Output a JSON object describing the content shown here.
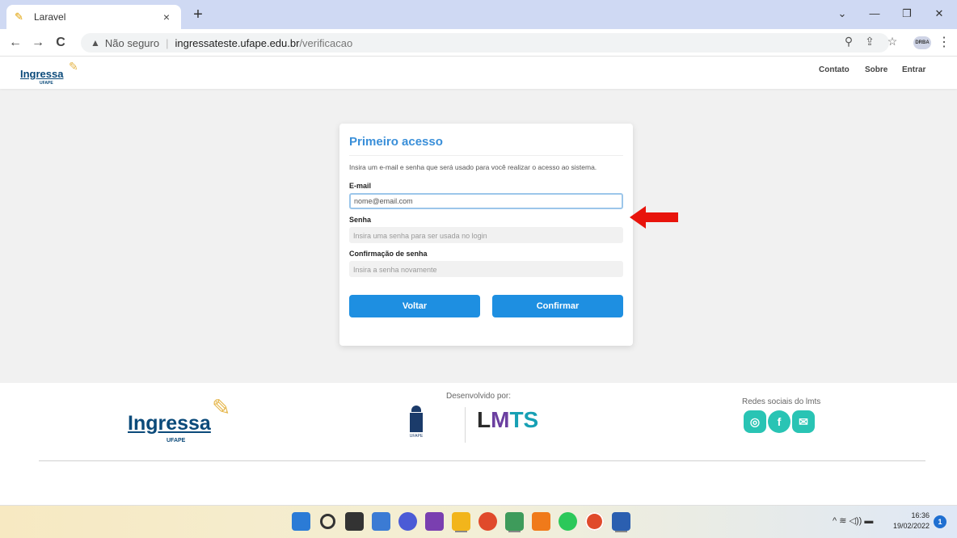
{
  "browser": {
    "tab_title": "Laravel",
    "tab_close": "×",
    "new_tab": "+",
    "security_text": "Não seguro",
    "url_host": "ingressateste.ufape.edu.br",
    "url_path": "/verificacao",
    "back": "←",
    "forward": "→",
    "reload": "C",
    "zoom_icon": "⚲",
    "share_icon": "⇪",
    "bookmark_icon": "☆",
    "profile_label": "DRBA",
    "menu": "⋮",
    "minimize": "—",
    "restore": "❐",
    "close": "✕",
    "chevron": "⌄"
  },
  "header": {
    "logo_text": "Ingressa",
    "logo_sub": "UFAPE",
    "nav": [
      "Contato",
      "Sobre",
      "Entrar"
    ]
  },
  "form": {
    "title": "Primeiro acesso",
    "description": "Insira um e-mail e senha que será usado para você realizar o acesso ao sistema.",
    "email_label": "E-mail",
    "email_value": "nome@email.com",
    "password_label": "Senha",
    "password_placeholder": "Insira uma senha para ser usada no login",
    "confirm_label": "Confirmação de senha",
    "confirm_placeholder": "Insira a senha novamente",
    "back_button": "Voltar",
    "confirm_button": "Confirmar"
  },
  "footer": {
    "logo_text": "Ingressa",
    "logo_sub": "UFAPE",
    "developed_by": "Desenvolvido por:",
    "emblem_text": "UFAPE",
    "lmts_l": "L",
    "lmts_m": "M",
    "lmts_ts": "TS",
    "social_label": "Redes sociais do lmts"
  },
  "taskbar": {
    "time": "16:36",
    "date": "19/02/2022",
    "notifications": "1",
    "tray": "^ ≋ ◁)) ▬"
  },
  "colors": {
    "accent": "#1e8fe1",
    "title": "#3a8fd9",
    "brand": "#0b4a7a",
    "social": "#29c4b4",
    "arrow": "#e8140c"
  }
}
